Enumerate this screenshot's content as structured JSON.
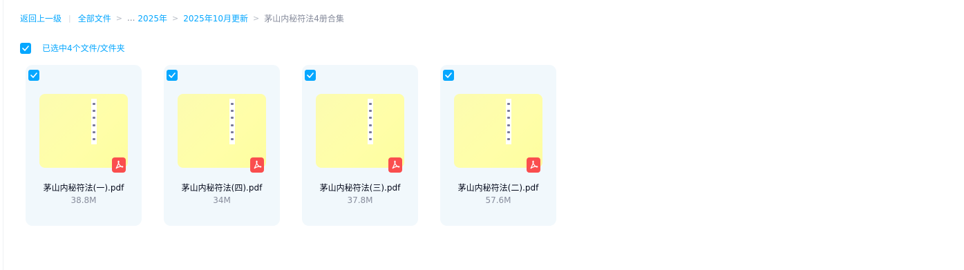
{
  "breadcrumb": {
    "back_label": "返回上一级",
    "items": [
      {
        "label": "全部文件"
      },
      {
        "label": "2025年"
      },
      {
        "label": "2025年10月更新"
      },
      {
        "label": "茅山内秘符法4册合集"
      }
    ],
    "ellipsis": "...",
    "separator": ">",
    "divider": "|"
  },
  "selection": {
    "checked": true,
    "text": "已选中4个文件/文件夹"
  },
  "files": [
    {
      "name": "茅山内秘符法(一).pdf",
      "size": "38.8M",
      "checked": true,
      "icon": "pdf-icon"
    },
    {
      "name": "茅山内秘符法(四).pdf",
      "size": "34M",
      "checked": true,
      "icon": "pdf-icon"
    },
    {
      "name": "茅山内秘符法(三).pdf",
      "size": "37.8M",
      "checked": true,
      "icon": "pdf-icon"
    },
    {
      "name": "茅山内秘符法(二).pdf",
      "size": "57.6M",
      "checked": true,
      "icon": "pdf-icon"
    }
  ],
  "colors": {
    "accent": "#06a7ff",
    "card_bg": "#f1f8fc",
    "pdf_badge": "#fa4e4e",
    "thumbnail": "#fdfda8"
  }
}
